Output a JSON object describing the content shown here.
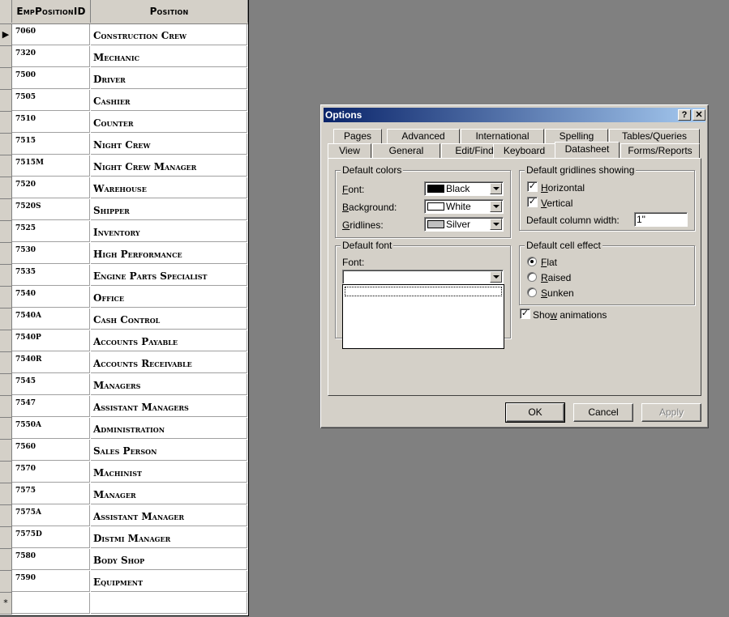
{
  "datasheet": {
    "columns": [
      "EmpPositionID",
      "Position"
    ],
    "current_row_marker": "▶",
    "new_row_marker": "*",
    "rows": [
      {
        "id": "7060",
        "position": "Construction Crew"
      },
      {
        "id": "7320",
        "position": "Mechanic"
      },
      {
        "id": "7500",
        "position": "Driver"
      },
      {
        "id": "7505",
        "position": "Cashier"
      },
      {
        "id": "7510",
        "position": "Counter"
      },
      {
        "id": "7515",
        "position": "Night Crew"
      },
      {
        "id": "7515M",
        "position": "Night Crew Manager"
      },
      {
        "id": "7520",
        "position": "Warehouse"
      },
      {
        "id": "7520S",
        "position": "Shipper"
      },
      {
        "id": "7525",
        "position": "Inventory"
      },
      {
        "id": "7530",
        "position": "High Performance"
      },
      {
        "id": "7535",
        "position": "Engine Parts Specialist"
      },
      {
        "id": "7540",
        "position": "Office"
      },
      {
        "id": "7540A",
        "position": "Cash Control"
      },
      {
        "id": "7540P",
        "position": "Accounts Payable"
      },
      {
        "id": "7540R",
        "position": "Accounts Receivable"
      },
      {
        "id": "7545",
        "position": "Managers"
      },
      {
        "id": "7547",
        "position": "Assistant Managers"
      },
      {
        "id": "7550A",
        "position": "Administration"
      },
      {
        "id": "7560",
        "position": "Sales Person"
      },
      {
        "id": "7570",
        "position": "Machinist"
      },
      {
        "id": "7575",
        "position": "Manager"
      },
      {
        "id": "7575A",
        "position": "Assistant Manager"
      },
      {
        "id": "7575D",
        "position": "Distmi Manager"
      },
      {
        "id": "7580",
        "position": "Body Shop"
      },
      {
        "id": "7590",
        "position": "Equipment"
      }
    ]
  },
  "dialog": {
    "title": "Options",
    "help_button": "?",
    "close_button": "✕",
    "tabs_row1": [
      "Pages",
      "Advanced",
      "International",
      "Spelling",
      "Tables/Queries"
    ],
    "tabs_row2": [
      "View",
      "General",
      "Edit/Find",
      "Keyboard",
      "Datasheet",
      "Forms/Reports"
    ],
    "active_tab": "Datasheet",
    "default_colors": {
      "legend": "Default colors",
      "font_label": "Font:",
      "font_value": "Black",
      "font_swatch": "#000000",
      "background_label": "Background:",
      "background_value": "White",
      "background_swatch": "#ffffff",
      "gridlines_label": "Gridlines:",
      "gridlines_value": "Silver",
      "gridlines_swatch": "#c0c0c0"
    },
    "default_gridlines": {
      "legend": "Default gridlines showing",
      "horizontal_label": "Horizontal",
      "horizontal_checked": true,
      "vertical_label": "Vertical",
      "vertical_checked": true,
      "column_width_label": "Default column width:",
      "column_width_value": "1\""
    },
    "default_font": {
      "legend": "Default font",
      "font_label": "Font:",
      "font_value": ""
    },
    "default_cell_effect": {
      "legend": "Default cell effect",
      "options": [
        "Flat",
        "Raised",
        "Sunken"
      ],
      "selected": "Flat"
    },
    "show_animations_label": "Show animations",
    "show_animations_checked": true,
    "buttons": {
      "ok": "OK",
      "cancel": "Cancel",
      "apply": "Apply"
    }
  },
  "colors": {
    "desktop": "#808080",
    "face": "#d4d0c8",
    "title_start": "#0a246a",
    "title_end": "#a6caf0"
  }
}
